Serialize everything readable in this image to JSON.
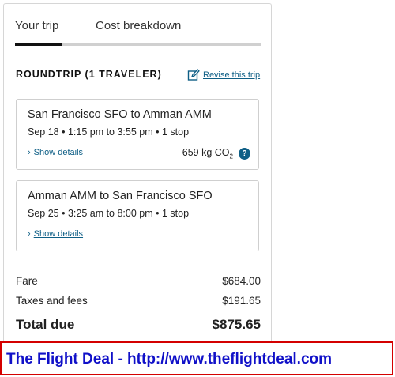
{
  "tabs": [
    {
      "label": "Your trip",
      "active": true
    },
    {
      "label": "Cost breakdown",
      "active": false
    }
  ],
  "trip": {
    "heading": "ROUNDTRIP (1 TRAVELER)",
    "revise_label": "Revise this trip"
  },
  "flights": [
    {
      "route": "San Francisco SFO to Amman AMM",
      "times": "Sep 18 • 1:15 pm to 3:55 pm • 1 stop",
      "details_label": "Show details",
      "co2_value": "659 kg CO",
      "co2_sub": "2",
      "help_glyph": "?"
    },
    {
      "route": "Amman AMM to San Francisco SFO",
      "times": "Sep 25 • 3:25 am to 8:00 pm • 1 stop",
      "details_label": "Show details"
    }
  ],
  "summary": {
    "fare_label": "Fare",
    "fare_value": "$684.00",
    "taxes_label": "Taxes and fees",
    "taxes_value": "$191.65",
    "total_label": "Total due",
    "total_value": "$875.65"
  },
  "banner": {
    "text": "The Flight Deal - http://www.theflightdeal.com"
  },
  "colors": {
    "link": "#0f5f86",
    "banner_border": "#d40000",
    "banner_text": "#1010c8",
    "tab_active_underline": "#111111"
  },
  "icons": {
    "revise": "edit-pencil-icon",
    "details": "chevron-right-icon",
    "help": "question-circle-icon"
  }
}
